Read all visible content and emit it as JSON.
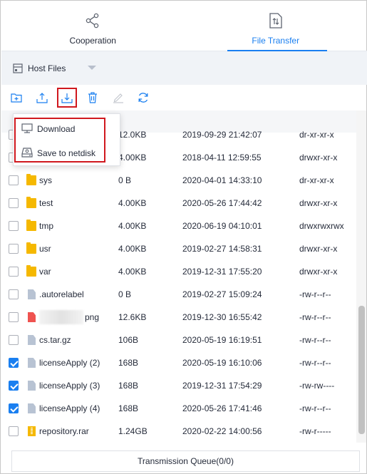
{
  "tabs": [
    {
      "label": "Cooperation",
      "icon": "share-icon",
      "active": false
    },
    {
      "label": "File Transfer",
      "icon": "file-transfer-icon",
      "active": true
    }
  ],
  "hostbar": {
    "label": "Host Files",
    "icon": "host-icon"
  },
  "toolbar": {
    "buttons": [
      "new-folder-icon",
      "upload-icon",
      "download-icon",
      "delete-icon",
      "edit-icon",
      "refresh-icon"
    ],
    "highlighted": "download-icon"
  },
  "dropdown": {
    "items": [
      {
        "label": "Download",
        "icon": "monitor-icon"
      },
      {
        "label": "Save to netdisk",
        "icon": "disk-icon"
      }
    ]
  },
  "rows": [
    {
      "name": "",
      "size": "12.0KB",
      "date": "2019-09-29 21:42:07",
      "perm": "dr-xr-xr-x",
      "type": "folder",
      "checked": false,
      "hidden": true
    },
    {
      "name": "",
      "size": "4.00KB",
      "date": "2018-04-11 12:59:55",
      "perm": "drwxr-xr-x",
      "type": "folder",
      "checked": false,
      "hidden": true
    },
    {
      "name": "sys",
      "size": "0 B",
      "date": "2020-04-01 14:33:10",
      "perm": "dr-xr-xr-x",
      "type": "folder",
      "checked": false
    },
    {
      "name": "test",
      "size": "4.00KB",
      "date": "2020-05-26 17:44:42",
      "perm": "drwxr-xr-x",
      "type": "folder",
      "checked": false
    },
    {
      "name": "tmp",
      "size": "4.00KB",
      "date": "2020-06-19 04:10:01",
      "perm": "drwxrwxrwx",
      "type": "folder",
      "checked": false
    },
    {
      "name": "usr",
      "size": "4.00KB",
      "date": "2019-02-27 14:58:31",
      "perm": "drwxr-xr-x",
      "type": "folder",
      "checked": false
    },
    {
      "name": "var",
      "size": "4.00KB",
      "date": "2019-12-31 17:55:20",
      "perm": "drwxr-xr-x",
      "type": "folder",
      "checked": false
    },
    {
      "name": ".autorelabel",
      "size": "0 B",
      "date": "2019-02-27 15:09:24",
      "perm": "-rw-r--r--",
      "type": "doc",
      "checked": false
    },
    {
      "name": "png",
      "size": "12.6KB",
      "date": "2019-12-30 16:55:42",
      "perm": "-rw-r--r--",
      "type": "image",
      "checked": false,
      "blurred": true
    },
    {
      "name": "cs.tar.gz",
      "size": "106B",
      "date": "2020-05-19 16:19:51",
      "perm": "-rw-r--r--",
      "type": "doc",
      "checked": false
    },
    {
      "name": "licenseApply (2)",
      "size": "168B",
      "date": "2020-05-19 16:10:06",
      "perm": "-rw-r--r--",
      "type": "doc",
      "checked": true
    },
    {
      "name": "licenseApply (3)",
      "size": "168B",
      "date": "2019-12-31 17:54:29",
      "perm": "-rw-rw----",
      "type": "doc",
      "checked": true
    },
    {
      "name": "licenseApply (4)",
      "size": "168B",
      "date": "2020-05-26 17:41:46",
      "perm": "-rw-r--r--",
      "type": "doc",
      "checked": true
    },
    {
      "name": "repository.rar",
      "size": "1.24GB",
      "date": "2020-02-22 14:00:56",
      "perm": "-rw-r-----",
      "type": "archive",
      "checked": false
    }
  ],
  "queue": {
    "label": "Transmission Queue(0/0)"
  },
  "colors": {
    "accent": "#1a7ff0",
    "highlight": "#d0181e",
    "folder": "#f5b800"
  }
}
